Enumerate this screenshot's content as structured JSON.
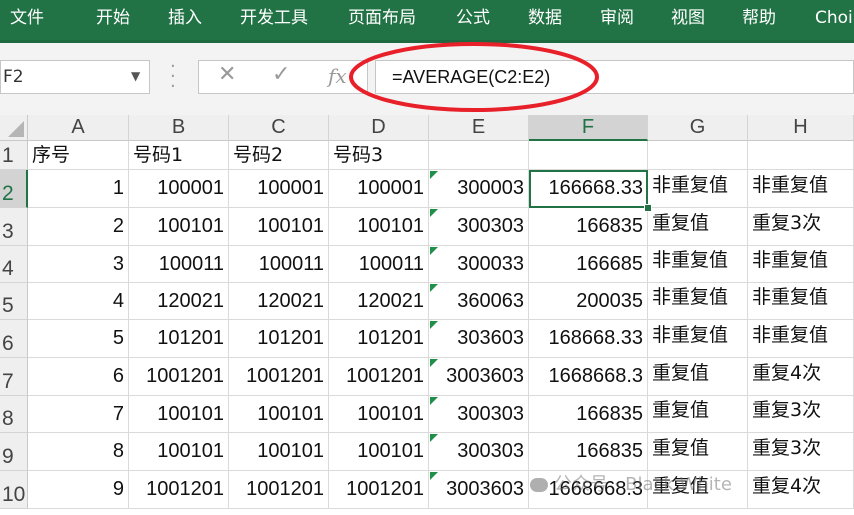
{
  "ribbon": {
    "tabs": [
      "文件",
      "开始",
      "插入",
      "开发工具",
      "页面布局",
      "公式",
      "数据",
      "审阅",
      "视图",
      "帮助",
      "Choi"
    ]
  },
  "formula_bar": {
    "name_box": "F2",
    "cancel_glyph": "✕",
    "enter_glyph": "✓",
    "fx_label": "fx",
    "formula": "=AVERAGE(C2:E2)"
  },
  "sheet": {
    "columns": [
      "A",
      "B",
      "C",
      "D",
      "E",
      "F",
      "G",
      "H"
    ],
    "selected_column": "F",
    "rows": [
      "1",
      "2",
      "3",
      "4",
      "5",
      "6",
      "7",
      "8",
      "9",
      "10"
    ],
    "selected_row": "2",
    "cells": [
      [
        "序号",
        "号码1",
        "号码2",
        "号码3",
        "",
        "",
        "",
        ""
      ],
      [
        "1",
        "100001",
        "100001",
        "100001",
        "300003",
        "166668.33",
        "非重复值",
        "非重复值"
      ],
      [
        "2",
        "100101",
        "100101",
        "100101",
        "300303",
        "166835",
        "重复值",
        "重复3次"
      ],
      [
        "3",
        "100011",
        "100011",
        "100011",
        "300033",
        "166685",
        "非重复值",
        "非重复值"
      ],
      [
        "4",
        "120021",
        "120021",
        "120021",
        "360063",
        "200035",
        "非重复值",
        "非重复值"
      ],
      [
        "5",
        "101201",
        "101201",
        "101201",
        "303603",
        "168668.33",
        "非重复值",
        "非重复值"
      ],
      [
        "6",
        "1001201",
        "1001201",
        "1001201",
        "3003603",
        "1668668.3",
        "重复值",
        "重复4次"
      ],
      [
        "7",
        "100101",
        "100101",
        "100101",
        "300303",
        "166835",
        "重复值",
        "重复3次"
      ],
      [
        "8",
        "100101",
        "100101",
        "100101",
        "300303",
        "166835",
        "重复值",
        "重复3次"
      ],
      [
        "9",
        "1001201",
        "1001201",
        "1001201",
        "3003603",
        "1668668.3",
        "重复值",
        "重复4次"
      ]
    ]
  },
  "annotation": {
    "color": "#e8202a"
  },
  "watermark": "公众号 · Black White",
  "colors": {
    "ribbon": "#217346",
    "indicator": "#1f8f4a"
  }
}
